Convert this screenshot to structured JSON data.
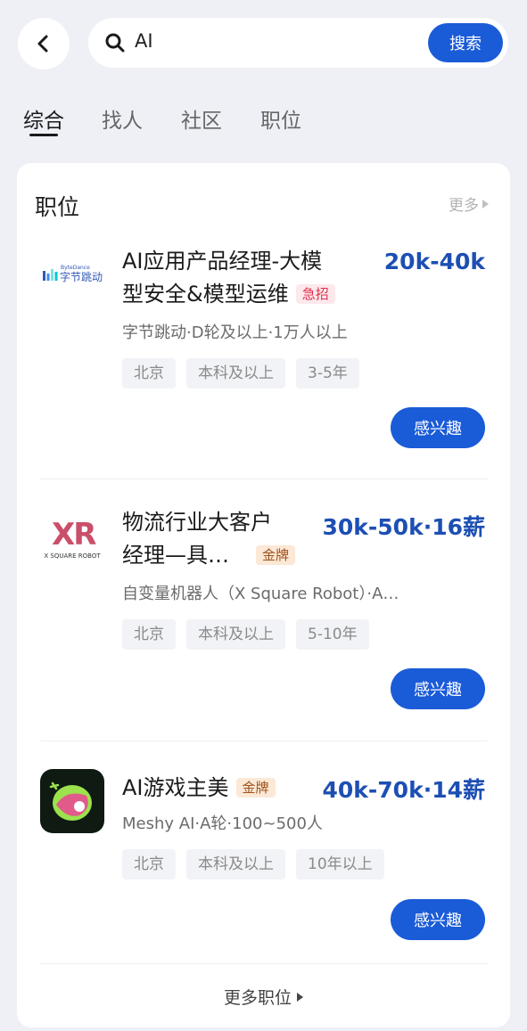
{
  "search": {
    "query": "AI",
    "button_label": "搜索"
  },
  "tabs": [
    {
      "label": "综合",
      "active": true
    },
    {
      "label": "找人",
      "active": false
    },
    {
      "label": "社区",
      "active": false
    },
    {
      "label": "职位",
      "active": false
    }
  ],
  "section": {
    "title": "职位",
    "more_label": "更多"
  },
  "jobs": [
    {
      "title_line1": "AI应用产品经理-大模",
      "title_line2": "型安全&模型运维",
      "badge": "急招",
      "salary": "20k-40k",
      "company": "字节跳动·D轮及以上·1万人以上",
      "tags": [
        "北京",
        "本科及以上",
        "3-5年"
      ],
      "button_label": "感兴趣",
      "logo": {
        "icon": "bytedance-logo",
        "small_text": "ByteDance",
        "text": "字节跳动"
      }
    },
    {
      "title_line1": "物流行业大客户",
      "title_line2": "经理—具…",
      "badge": "金牌",
      "salary": "30k-50k·16薪",
      "company": "自变量机器人（X Square Robot）·A…",
      "tags": [
        "北京",
        "本科及以上",
        "5-10年"
      ],
      "button_label": "感兴趣",
      "logo": {
        "icon": "x-square-robot-logo",
        "mark": "XR",
        "text": "X SQUARE ROBOT"
      }
    },
    {
      "title_line1": "AI游戏主美",
      "badge": "金牌",
      "salary": "40k-70k·14薪",
      "company": "Meshy AI·A轮·100~500人",
      "tags": [
        "北京",
        "本科及以上",
        "10年以上"
      ],
      "button_label": "感兴趣",
      "logo": {
        "icon": "meshy-logo"
      }
    }
  ],
  "footer": {
    "more_jobs_label": "更多职位"
  },
  "colors": {
    "accent": "#1a5bd8",
    "salary": "#1d4fb3",
    "background": "#eef0f6"
  }
}
